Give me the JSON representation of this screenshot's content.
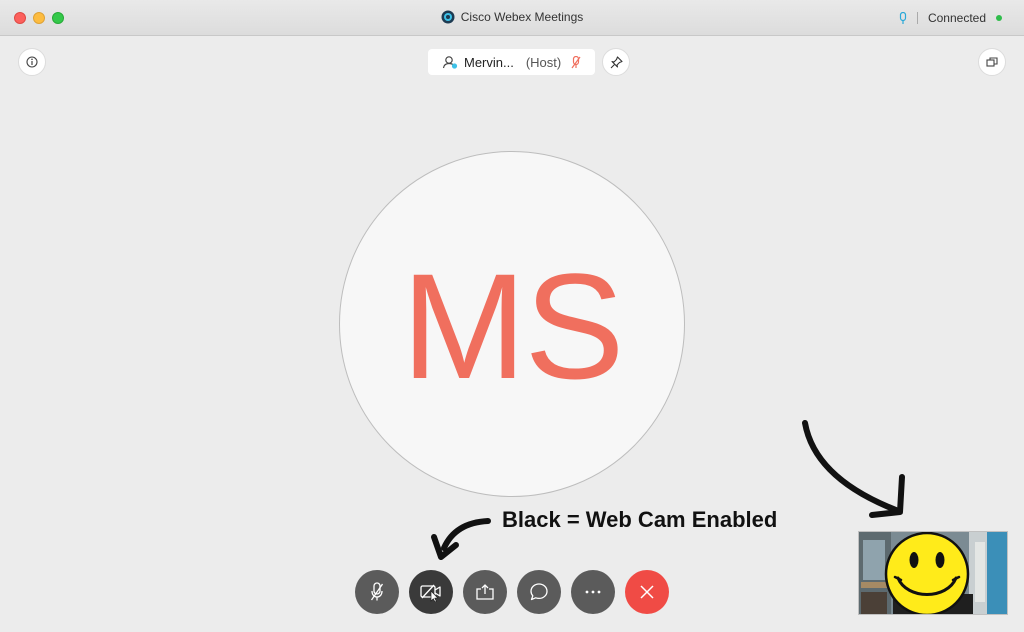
{
  "window": {
    "title": "Cisco Webex Meetings",
    "connection_status": "Connected"
  },
  "host": {
    "name": "Mervin...",
    "role": "(Host)"
  },
  "participant": {
    "initials": "MS"
  },
  "annotation": {
    "text": "Black = Web Cam Enabled"
  },
  "icons": {
    "info": "info-icon",
    "pin": "pin-icon",
    "layout": "layout-icon",
    "mute": "microphone-muted-icon",
    "video": "video-camera-icon",
    "share": "share-icon",
    "chat": "chat-icon",
    "more": "more-icon",
    "end": "close-icon"
  },
  "colors": {
    "initials": "#f06f5e",
    "end_button": "#f04b45",
    "control_button": "#5b5b5b",
    "video_enabled_button": "#3a3a3a",
    "connected_dot": "#2fbd4b"
  }
}
